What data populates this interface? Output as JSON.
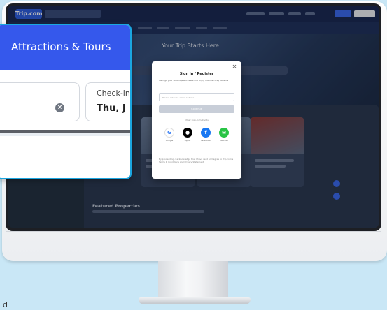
{
  "header": {
    "logo_text": "Trip.com"
  },
  "hero": {
    "title": "Your Trip Starts Here"
  },
  "sections": {
    "featured_title": "Featured Properties"
  },
  "modal": {
    "title": "Sign in / Register",
    "subtitle": "Manage your bookings with ease and enjoy member-only benefits",
    "email_placeholder": "Please enter an email address",
    "continue_label": "Continue",
    "other_methods": "Other sign-in methods",
    "social": [
      {
        "label": "Google",
        "icon": "google-icon",
        "color": "#ffffff"
      },
      {
        "label": "Apple",
        "icon": "apple-icon",
        "color": "#000000"
      },
      {
        "label": "Facebook",
        "icon": "facebook-icon",
        "color": "#1877f2"
      },
      {
        "label": "WeChat",
        "icon": "wechat-icon",
        "color": "#28c445"
      }
    ],
    "terms": "By proceeding, I acknowledge that I have read and agree to Trip.com's Terms & Conditions and Privacy Statement"
  },
  "callout": {
    "title": "Attractions & Tours",
    "checkin_label": "Check-in",
    "checkin_value": "Thu, J"
  },
  "colors": {
    "accent": "#3558ec",
    "background": "#c9e7f6",
    "callout_border": "#1ba6e0"
  },
  "footer_mark": "d"
}
